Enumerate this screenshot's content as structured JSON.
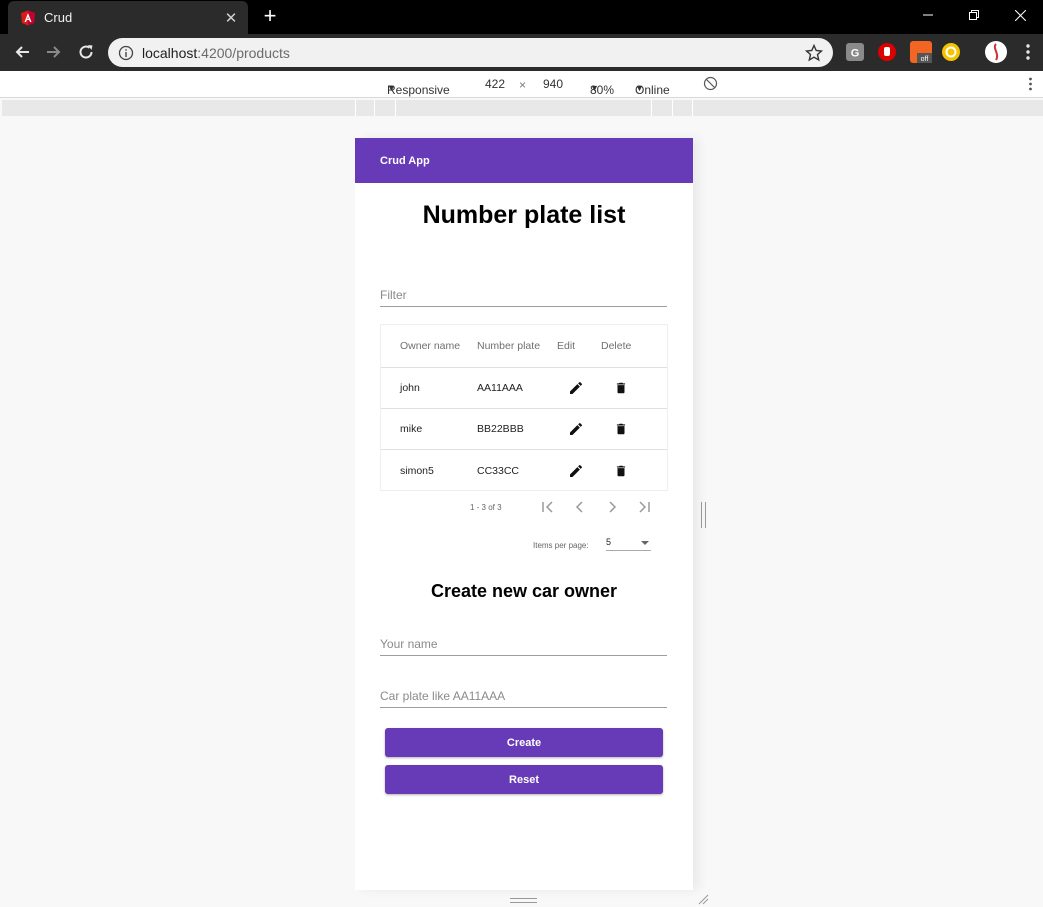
{
  "browser": {
    "tab_title": "Crud",
    "url_host": "localhost",
    "url_path": ":4200/products",
    "new_tab_icon": "plus-icon",
    "window_controls": [
      "minimize-icon",
      "restore-icon",
      "close-icon"
    ]
  },
  "device_toolbar": {
    "mode": "Responsive",
    "width": "422",
    "times": "×",
    "height": "940",
    "zoom": "80%",
    "network": "Online"
  },
  "app": {
    "title": "Crud App",
    "page_title": "Number plate list",
    "filter_placeholder": "Filter",
    "table": {
      "headers": [
        "Owner name",
        "Number plate",
        "Edit",
        "Delete"
      ],
      "rows": [
        {
          "owner": "john",
          "plate": "AA11AAA"
        },
        {
          "owner": "mike",
          "plate": "BB22BBB"
        },
        {
          "owner": "simon5",
          "plate": "CC33CC"
        }
      ]
    },
    "paginator": {
      "range": "1 - 3 of 3",
      "items_per_page_label": "Items per page:",
      "items_per_page_value": "5"
    },
    "create_section": {
      "title": "Create new car owner",
      "name_placeholder": "Your name",
      "plate_placeholder": "Car plate like AA11AAA",
      "create_label": "Create",
      "reset_label": "Reset"
    }
  },
  "colors": {
    "primary": "#673ab7",
    "chrome_dark": "#2b2b2b"
  }
}
